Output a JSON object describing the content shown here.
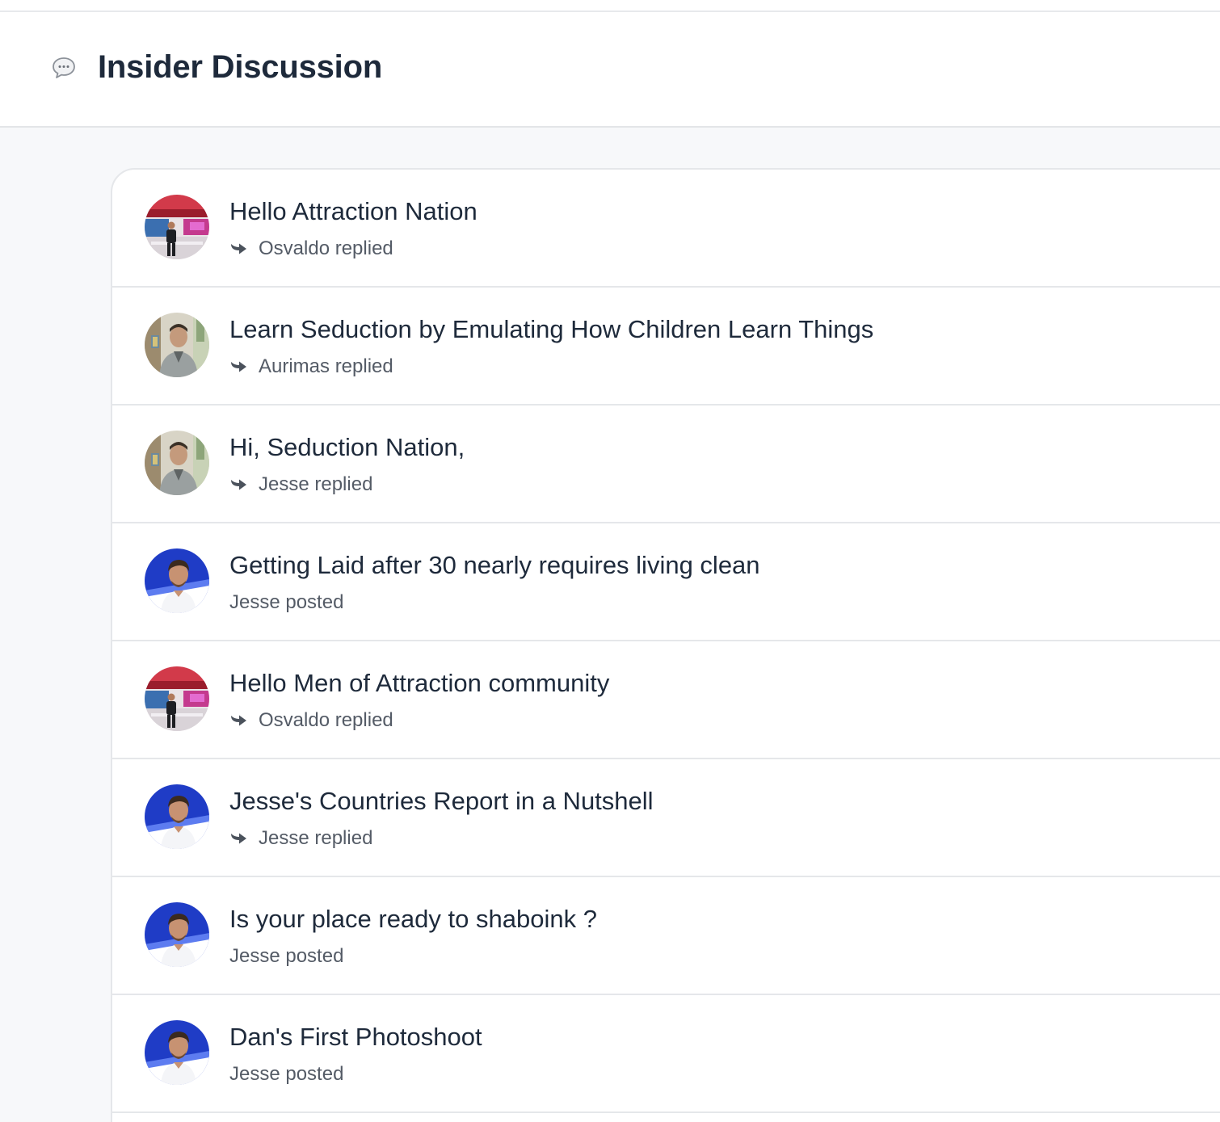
{
  "header": {
    "title": "Insider Discussion",
    "icon": "chat-bubble-icon"
  },
  "threads": [
    {
      "title": "Hello Attraction Nation",
      "author": "Osvaldo",
      "action": "replied",
      "meta": "Osvaldo replied",
      "avatar": "osvaldo",
      "icon": "reply-arrow-icon"
    },
    {
      "title": "Learn Seduction by Emulating How Children Learn Things",
      "author": "Aurimas",
      "action": "replied",
      "meta": "Aurimas replied",
      "avatar": "aurimas",
      "icon": "reply-arrow-icon"
    },
    {
      "title": "Hi, Seduction Nation,",
      "author": "Jesse",
      "action": "replied",
      "meta": "Jesse replied",
      "avatar": "aurimas",
      "icon": "reply-arrow-icon"
    },
    {
      "title": "Getting Laid after 30 nearly requires living clean",
      "author": "Jesse",
      "action": "posted",
      "meta": "Jesse posted",
      "avatar": "jesse",
      "icon": ""
    },
    {
      "title": "Hello Men of Attraction community",
      "author": "Osvaldo",
      "action": "replied",
      "meta": "Osvaldo replied",
      "avatar": "osvaldo",
      "icon": "reply-arrow-icon"
    },
    {
      "title": "Jesse's Countries Report in a Nutshell",
      "author": "Jesse",
      "action": "replied",
      "meta": "Jesse replied",
      "avatar": "jesse",
      "icon": "reply-arrow-icon"
    },
    {
      "title": "Is your place ready to shaboink ?",
      "author": "Jesse",
      "action": "posted",
      "meta": "Jesse posted",
      "avatar": "jesse",
      "icon": ""
    },
    {
      "title": "Dan's First Photoshoot",
      "author": "Jesse",
      "action": "posted",
      "meta": "Jesse posted",
      "avatar": "jesse",
      "icon": ""
    }
  ],
  "colors": {
    "title": "#1e2a3b",
    "meta": "#545b66",
    "border": "#e5e7ea",
    "background": "#f7f8fa",
    "jesse_avatar_bg": "#1f3cc6"
  }
}
